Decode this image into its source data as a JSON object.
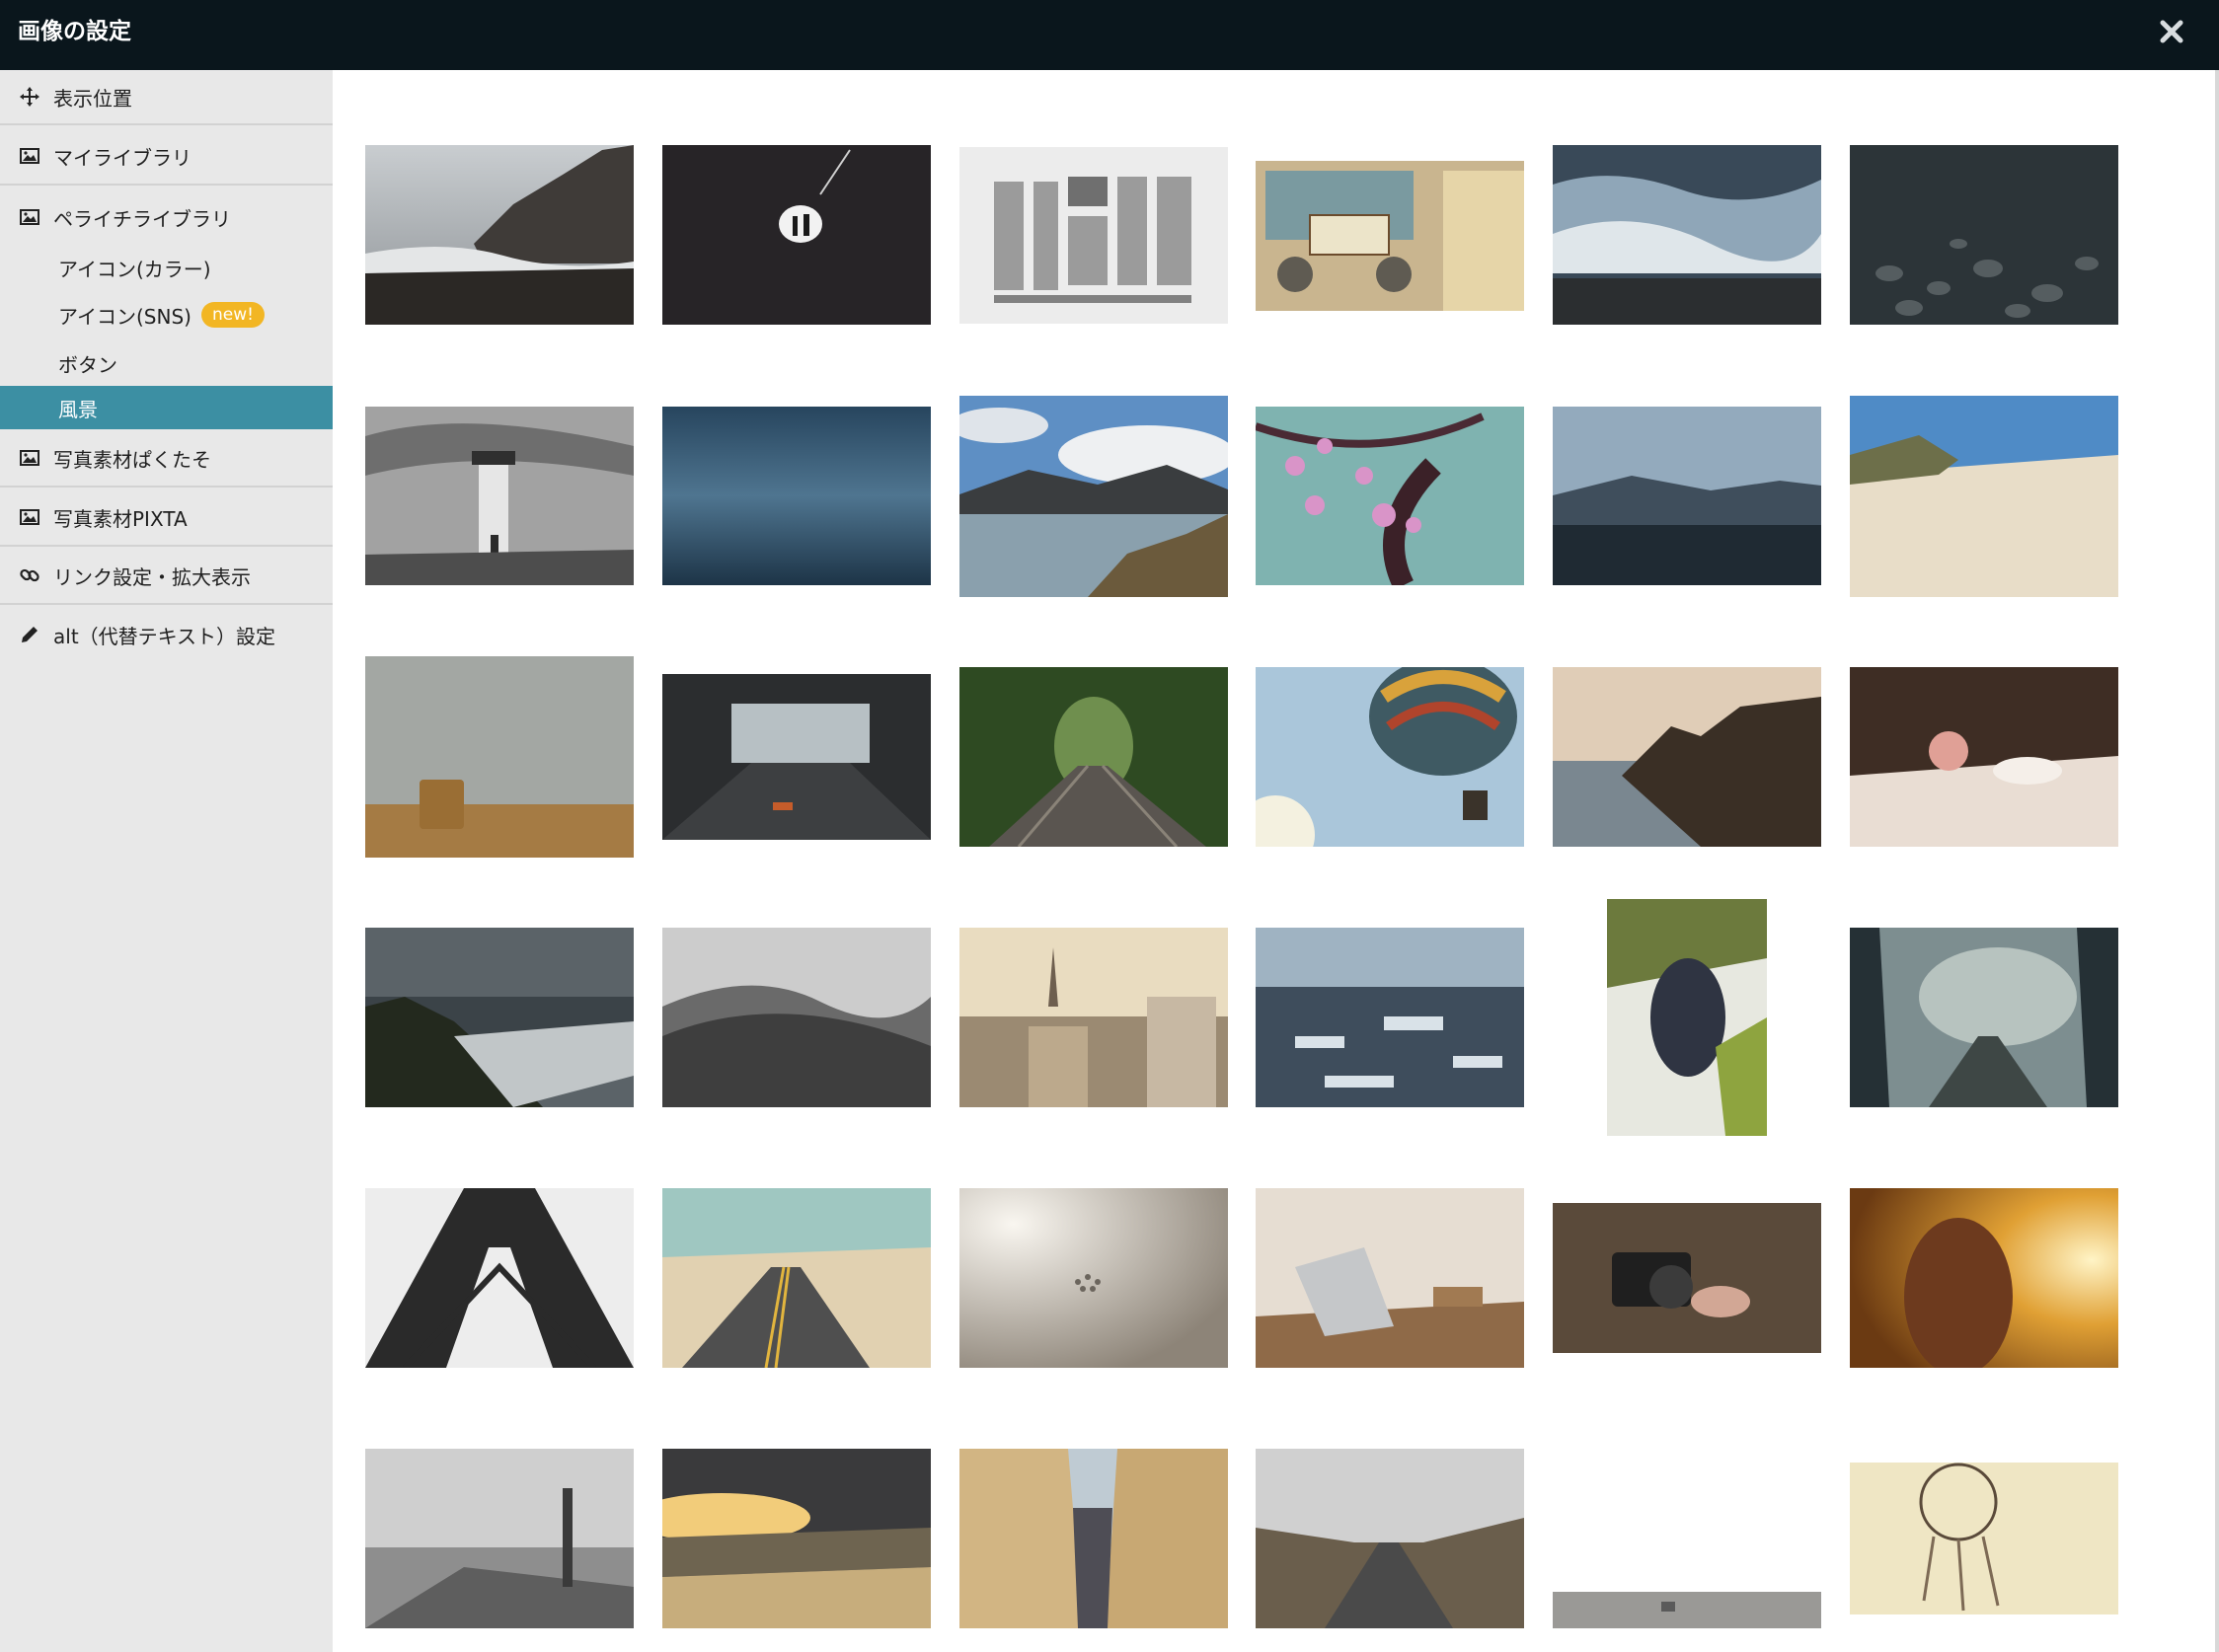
{
  "window": {
    "title": "画像の設定",
    "close_label": "×"
  },
  "sidebar": {
    "items": [
      {
        "label": "表示位置",
        "icon": "move-icon"
      },
      {
        "label": "マイライブラリ",
        "icon": "image-icon"
      },
      {
        "label": "ペライチライブラリ",
        "icon": "image-icon"
      },
      {
        "label": "アイコン(カラー)"
      },
      {
        "label": "アイコン(SNS)",
        "badge": "new!"
      },
      {
        "label": "ボタン"
      },
      {
        "label": "風景",
        "selected": true
      },
      {
        "label": "写真素材ぱくたそ",
        "icon": "image-icon"
      },
      {
        "label": "写真素材PIXTA",
        "icon": "image-icon"
      },
      {
        "label": "リンク設定・拡大表示",
        "icon": "link-icon"
      },
      {
        "label": "alt（代替テキスト）設定",
        "icon": "pencil-icon"
      }
    ]
  },
  "gallery": {
    "category": "風景",
    "images": [
      "coastal-cliffs-waves",
      "dark-cave-silhouettes",
      "typography-type-specimens",
      "vintage-tuk-tuk-license-plate",
      "ocean-waves-rocks",
      "dark-pebbles",
      "lighthouse-bw",
      "blue-water-surface",
      "mountain-lake-reflection",
      "cherry-blossom-branch",
      "coastal-mountains-fjord",
      "sandy-beach-palms",
      "foggy-field-hay-bale",
      "tunnel-light",
      "forest-railway-tracks",
      "hot-air-balloon",
      "sea-cliffs-sunset",
      "teacup-with-flower",
      "stormy-coastline",
      "bw-hills-fence",
      "european-city-rooftops",
      "snowy-town-rooftops",
      "grapes-on-vine",
      "misty-forest-railway",
      "bw-steel-bridge-tower",
      "desert-road",
      "airplanes-in-haze",
      "laptop-on-wooden-desk",
      "hands-holding-camera",
      "girl-in-golden-field",
      "bw-pier-lighthouse",
      "sunset-beach",
      "narrow-street-buildings",
      "mountain-valley-road",
      "misty-field-hay-bales",
      "dreamcatcher"
    ]
  }
}
